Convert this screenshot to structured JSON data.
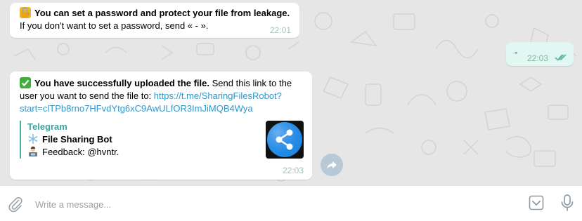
{
  "messages": [
    {
      "direction": "incoming",
      "emoji_icon": "locked-with-key-icon",
      "bold_text": "You can set a password and protect your file from leakage.",
      "text": "If you don't want to set a password, send « - ».",
      "time": "22:01"
    },
    {
      "direction": "outgoing",
      "text": "-",
      "time": "22:03",
      "status_icon": "double-check-icon"
    },
    {
      "direction": "incoming",
      "emoji_icon": "check-mark-button-icon",
      "bold_text": "You have successfully uploaded the file.",
      "text_line1": "Send this link to the",
      "text_line2": "user you want to send the file to:",
      "link_part1": "https://t.me/SharingFilesRobot?",
      "link_part2": "start=clTPb8rno7HFvdYtg6xC9AwULfOR3ImJiMQB4Wya",
      "preview": {
        "site": "Telegram",
        "title": "File Sharing Bot",
        "title_icon": "snowflake-icon",
        "description": "Feedback: @hvntr.",
        "description_icon": "technologist-icon",
        "image_icon": "share-icon"
      },
      "time": "22:03"
    }
  ],
  "composer": {
    "placeholder": "Write a message...",
    "attach_icon": "paperclip-icon",
    "bot_keyboard_icon": "bot-keyboard-icon",
    "mic_icon": "microphone-icon"
  },
  "forward_icon": "forward-icon",
  "colors": {
    "link": "#3395c7",
    "preview_accent": "#4bb0a4",
    "outgoing_bubble": "#e1f7f2",
    "chat_background": "#e6e6e6"
  }
}
